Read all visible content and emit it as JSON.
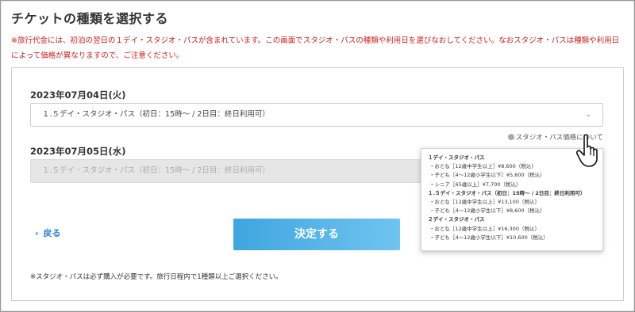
{
  "page": {
    "title": "チケットの種類を選択する",
    "notice": "※旅行代金には、初泊の翌日の１デイ・スタジオ・パスが含まれています。この画面でスタジオ・パスの種類や利用日を選びなおしてください。なおスタジオ・パスは種類や利用日によって価格が異なりますので、ご注意ください。"
  },
  "day1": {
    "date": "2023年07月04日(火)",
    "selected": "１.５デイ・スタジオ・パス（初日：15時～ / 2日目：終日利用可）"
  },
  "day2": {
    "date": "2023年07月05日(水)",
    "selected": "１.５デイ・スタジオ・パス（初日：15時～ / 2日目：終日利用可）"
  },
  "price_link": "スタジオ・パス価格について",
  "tooltip": {
    "sections": [
      {
        "heading": "１デイ・スタジオ・パス",
        "items": [
          "・おとな［12歳中学生以上］¥8,600（税込）",
          "・子ども［4～12歳小学生以下］¥5,600（税込）",
          "・シニア［65歳以上］¥7,700（税込）"
        ]
      },
      {
        "heading": "１.５デイ・スタジオ・パス（初日：15時～ / 2日目：終日利用可）",
        "items": [
          "・おとな［12歳中学生以上］¥13,100（税込）",
          "・子ども［4～12歳小学生以下］¥8,600（税込）"
        ]
      },
      {
        "heading": "２デイ・スタジオ・パス",
        "items": [
          "・おとな［12歳中学生以上］¥16,300（税込）",
          "・子ども［4～12歳小学生以下］¥10,600（税込）"
        ]
      }
    ]
  },
  "back_label": "戻る",
  "decide_label": "決定する",
  "footnote": "※スタジオ・パスは必ず購入が必要です。旅行日程内で1種類以上ご選択ください。",
  "colors": {
    "notice": "#d01c1c",
    "link": "#2b7bd4",
    "button": "#4ab0e6"
  }
}
